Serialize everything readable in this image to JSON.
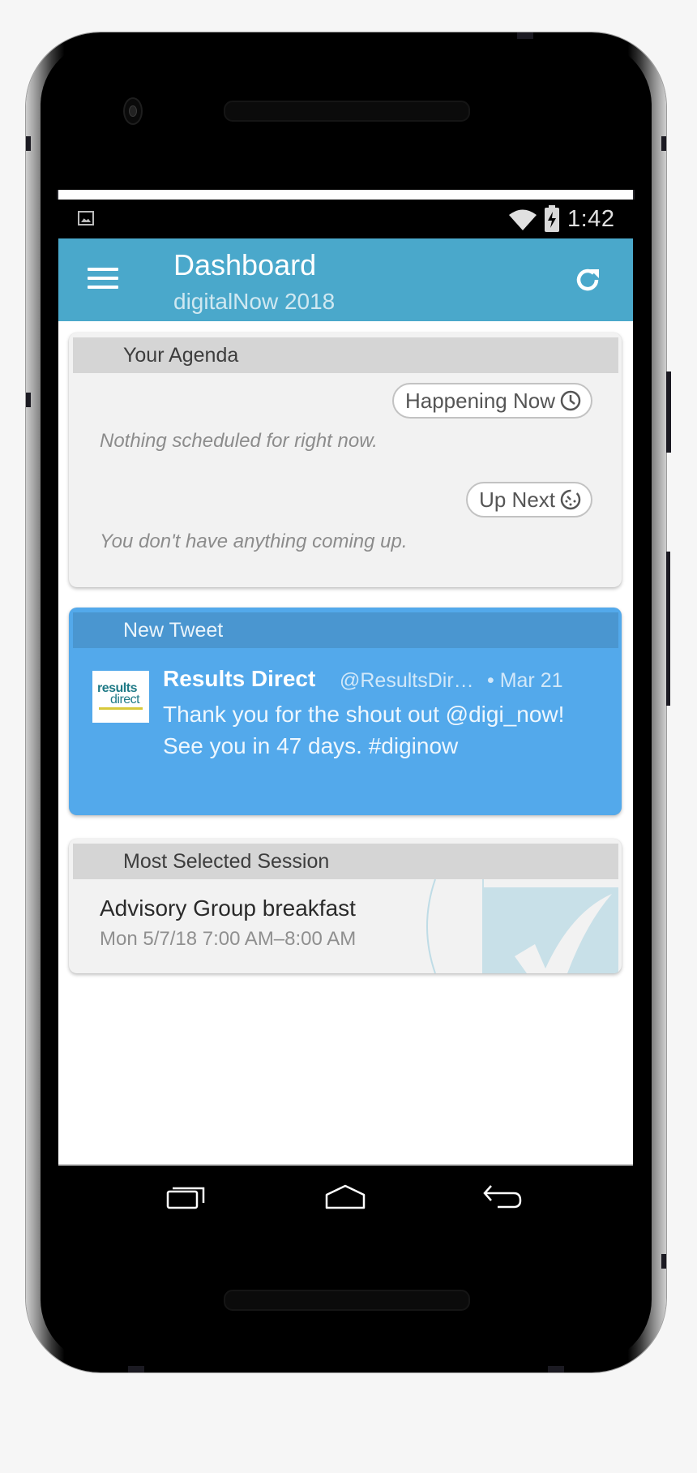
{
  "statusbar": {
    "time": "1:42",
    "icons": [
      "image-notification-icon",
      "wifi-icon",
      "battery-charging-icon"
    ]
  },
  "appbar": {
    "title": "Dashboard",
    "subtitle": "digitalNow 2018",
    "menu_icon": "hamburger-menu-icon",
    "refresh_icon": "refresh-icon",
    "color": "#4aa8cb"
  },
  "agenda": {
    "header": "Your Agenda",
    "happening_now_label": "Happening Now",
    "happening_now_icon": "clock-icon",
    "happening_now_empty": "Nothing scheduled for right now.",
    "up_next_label": "Up Next",
    "up_next_icon": "timer-icon",
    "up_next_empty": "You don't have anything coming up."
  },
  "tweet": {
    "header": "New Tweet",
    "logo_line1": "results",
    "logo_line2": "direct",
    "author": "Results Direct",
    "handle": "@ResultsDir…",
    "date": "• Mar 21",
    "text": "Thank you for the shout out @digi_now! See you in 47 days. #diginow",
    "color": "#53a9eb"
  },
  "session": {
    "header": "Most Selected Session",
    "title": "Advisory Group breakfast",
    "time": "Mon 5/7/18 7:00 AM–8:00 AM"
  },
  "navbar": {
    "buttons": [
      "recent-apps",
      "home",
      "back"
    ]
  }
}
